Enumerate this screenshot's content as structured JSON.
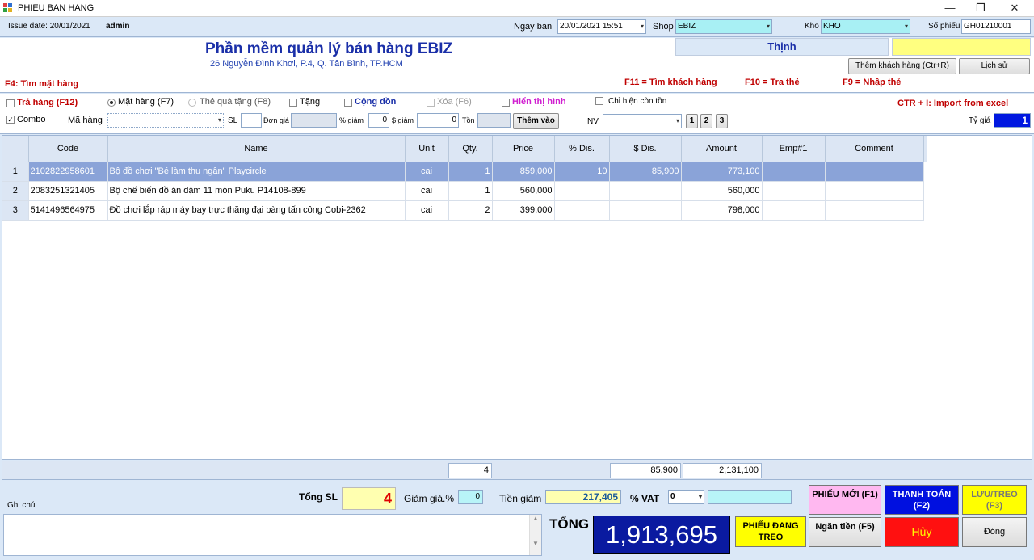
{
  "window": {
    "title": "PHIEU BAN HANG",
    "minimize": "—",
    "restore": "❐",
    "close": "✕"
  },
  "topbar": {
    "issue_date": "Issue date: 20/01/2021",
    "user": "admin",
    "ngay_ban_label": "Ngày bán",
    "ngay_ban_value": "20/01/2021 15:51",
    "shop_label": "Shop",
    "shop_value": "EBIZ",
    "kho_label": "Kho",
    "kho_value": "KHO",
    "so_phieu_label": "Số phiếu",
    "so_phieu_value": "GH01210001"
  },
  "header": {
    "app_title": "Phần mềm quản lý bán hàng EBIZ",
    "address": "26 Nguyễn Đình Khơi, P.4, Q. Tân Bình, TP.HCM",
    "customer": "Thịnh",
    "add_customer": "Thêm khách hàng (Ctr+R)",
    "history": "Lịch sử",
    "f4": "F4: Tìm mặt hàng",
    "f11": "F11 = Tìm khách hàng",
    "f10": "F10 = Tra thẻ",
    "f9": "F9 = Nhập thẻ"
  },
  "options": {
    "tra_hang": "Trả hàng (F12)",
    "mat_hang": "Mặt hàng (F7)",
    "the_qua_tang": "Thẻ quà tặng (F8)",
    "tang": "Tặng",
    "cong_don": "Cộng dồn",
    "xoa": "Xóa (F6)",
    "hien_thi_hinh": "Hiển thị hình",
    "chi_hien_con_ton": "Chỉ hiện còn tồn",
    "import": "CTR + I: Import from excel",
    "combo": "Combo",
    "ma_hang": "Mã hàng",
    "sl": "SL",
    "don_gia": "Đơn giá",
    "pct_giam": "% giảm",
    "pct_giam_val": "0",
    "d_giam": "$ giảm",
    "d_giam_val": "0",
    "ton": "Tồn",
    "them_vao": "Thêm vào",
    "nv": "NV",
    "n1": "1",
    "n2": "2",
    "n3": "3",
    "ty_gia": "Tỷ giá",
    "ty_gia_val": "1"
  },
  "grid": {
    "columns": [
      "Code",
      "Name",
      "Unit",
      "Qty.",
      "Price",
      "% Dis.",
      "$ Dis.",
      "Amount",
      "Emp#1",
      "Comment"
    ],
    "rows": [
      {
        "n": "1",
        "code": "2102822958601",
        "name": "Bộ đồ chơi \"Bé làm thu ngân\" Playcircle",
        "unit": "cai",
        "qty": "1",
        "price": "859,000",
        "pdis": "10",
        "ddis": "85,900",
        "amount": "773,100",
        "emp": "",
        "comment": ""
      },
      {
        "n": "2",
        "code": "2083251321405",
        "name": "Bộ chế biến đồ ăn dặm 11 món Puku P14108-899",
        "unit": "cai",
        "qty": "1",
        "price": "560,000",
        "pdis": "",
        "ddis": "",
        "amount": "560,000",
        "emp": "",
        "comment": ""
      },
      {
        "n": "3",
        "code": "5141496564975",
        "name": "Đồ chơi lắp ráp máy bay trực thăng đại bàng tấn công Cobi-2362",
        "unit": "cai",
        "qty": "2",
        "price": "399,000",
        "pdis": "",
        "ddis": "",
        "amount": "798,000",
        "emp": "",
        "comment": ""
      }
    ]
  },
  "totals": {
    "qty": "4",
    "ddis": "85,900",
    "amount": "2,131,100"
  },
  "footer": {
    "ghi_chu": "Ghi chú",
    "tong_sl_label": "Tổng SL",
    "tong_sl": "4",
    "giam_gia_label": "Giảm giá.%",
    "giam_gia": "0",
    "tien_giam_label": "Tiền giảm",
    "tien_giam": "217,405",
    "vat_label": "% VAT",
    "vat": "0",
    "tong_label": "TỔNG",
    "tong": "1,913,695",
    "phieu_moi": "PHIẾU MỚI (F1)",
    "thanh_toan": "THANH TOÁN (F2)",
    "luu_treo": "LƯU/TREO (F3)",
    "phieu_dang_treo": "PHIẾU ĐANG TREO",
    "ngan_tien": "Ngăn tiền (F5)",
    "huy": "Hủy",
    "dong": "Đóng"
  }
}
